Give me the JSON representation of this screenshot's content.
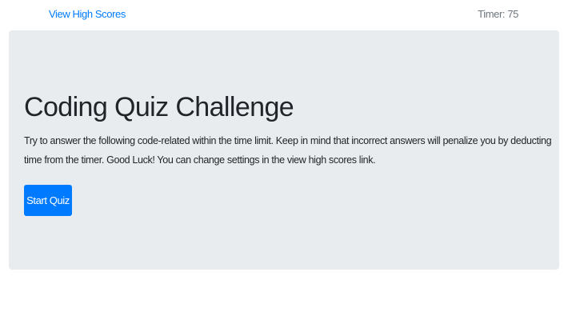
{
  "header": {
    "high_scores_link": "View High Scores",
    "timer_text": "Timer: 75"
  },
  "main": {
    "title": "Coding Quiz Challenge",
    "description": "Try to answer the following code-related within the time limit. Keep in mind that incorrect answers will penalize you by deducting time from the timer. Good Luck! You can change settings in the view high scores link.",
    "start_button_label": "Start Quiz"
  },
  "colors": {
    "primary": "#007bff",
    "jumbotron_bg": "#e9ecef",
    "text": "#212529",
    "muted": "#6c757d"
  }
}
